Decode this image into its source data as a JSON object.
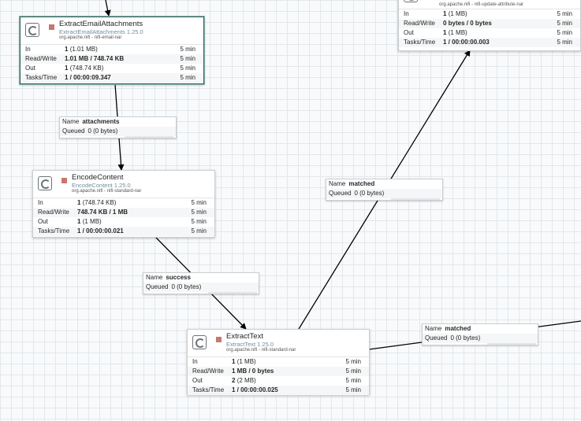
{
  "processors": {
    "extract_email": {
      "name": "ExtractEmailAttachments",
      "type": "ExtractEmailAttachments 1.25.0",
      "bundle": "org.apache.nifi - nifi-email-nar",
      "in_count": "1",
      "in_size": "(1.01 MB)",
      "read_write": "1.01 MB / 748.74 KB",
      "out_count": "1",
      "out_size": "(748.74 KB)",
      "tasks_time": "1 / 00:00:09.347",
      "window": "5 min"
    },
    "encode": {
      "name": "EncodeContent",
      "type": "EncodeContent 1.25.0",
      "bundle": "org.apache.nifi - nifi-standard-nar",
      "in_count": "1",
      "in_size": "(748.74 KB)",
      "read_write": "748.74 KB / 1 MB",
      "out_count": "1",
      "out_size": "(1 MB)",
      "tasks_time": "1 / 00:00:00.021",
      "window": "5 min"
    },
    "extract_text": {
      "name": "ExtractText",
      "type": "ExtractText 1.25.0",
      "bundle": "org.apache.nifi - nifi-standard-nar",
      "in_count": "1",
      "in_size": "(1 MB)",
      "read_write": "1 MB / 0 bytes",
      "out_count": "2",
      "out_size": "(2 MB)",
      "tasks_time": "1 / 00:00:00.025",
      "window": "5 min"
    },
    "update_attr": {
      "bundle": "org.apache.nifi - nifi-update-attribute-nar",
      "in_count": "1",
      "in_size": "(1 MB)",
      "read_write": "0 bytes / 0 bytes",
      "out_count": "1",
      "out_size": "(1 MB)",
      "tasks_time": "1 / 00:00:00.003",
      "window": "5 min"
    }
  },
  "labels": {
    "in": "In",
    "read_write": "Read/Write",
    "out": "Out",
    "tasks_time": "Tasks/Time",
    "name": "Name",
    "queued": "Queued"
  },
  "connections": {
    "attachments": {
      "name": "attachments",
      "queued": "0 (0 bytes)"
    },
    "success": {
      "name": "success",
      "queued": "0 (0 bytes)"
    },
    "matched_up": {
      "name": "matched",
      "queued": "0 (0 bytes)"
    },
    "matched_right": {
      "name": "matched",
      "queued": "0 (0 bytes)"
    }
  }
}
